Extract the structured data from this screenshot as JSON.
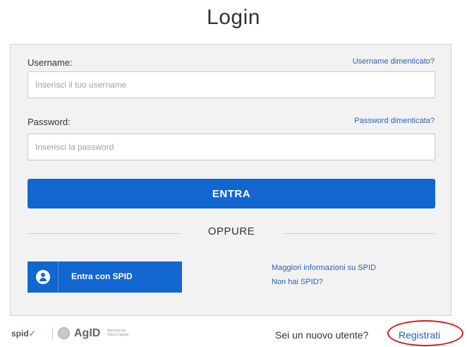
{
  "page": {
    "title": "Login"
  },
  "form": {
    "username_label": "Username:",
    "username_forgot": "Username dimenticato?",
    "username_placeholder": "Inserisci il tuo username",
    "password_label": "Password:",
    "password_forgot": "Password dimenticata?",
    "password_placeholder": "Inserisci la password",
    "submit_label": "ENTRA"
  },
  "divider": {
    "label": "OPPURE"
  },
  "spid": {
    "button_label": "Entra con SPID",
    "more_info": "Maggiori informazioni su SPID",
    "no_spid": "Non hai SPID?"
  },
  "footer": {
    "spid_logo": "spid",
    "agid_logo": "AgID",
    "agid_subtitle": "Agenzia per l'Italia Digitale",
    "new_user_text": "Sei un nuovo utente?",
    "register_link": "Registrati"
  },
  "colors": {
    "primary": "#1266d0",
    "link": "#2a5fb8",
    "highlight": "#d61a1a"
  },
  "icons": {
    "spid_button": "user-circle-icon",
    "spid_check": "checkmark-icon",
    "agid_emblem": "emblem-icon"
  }
}
